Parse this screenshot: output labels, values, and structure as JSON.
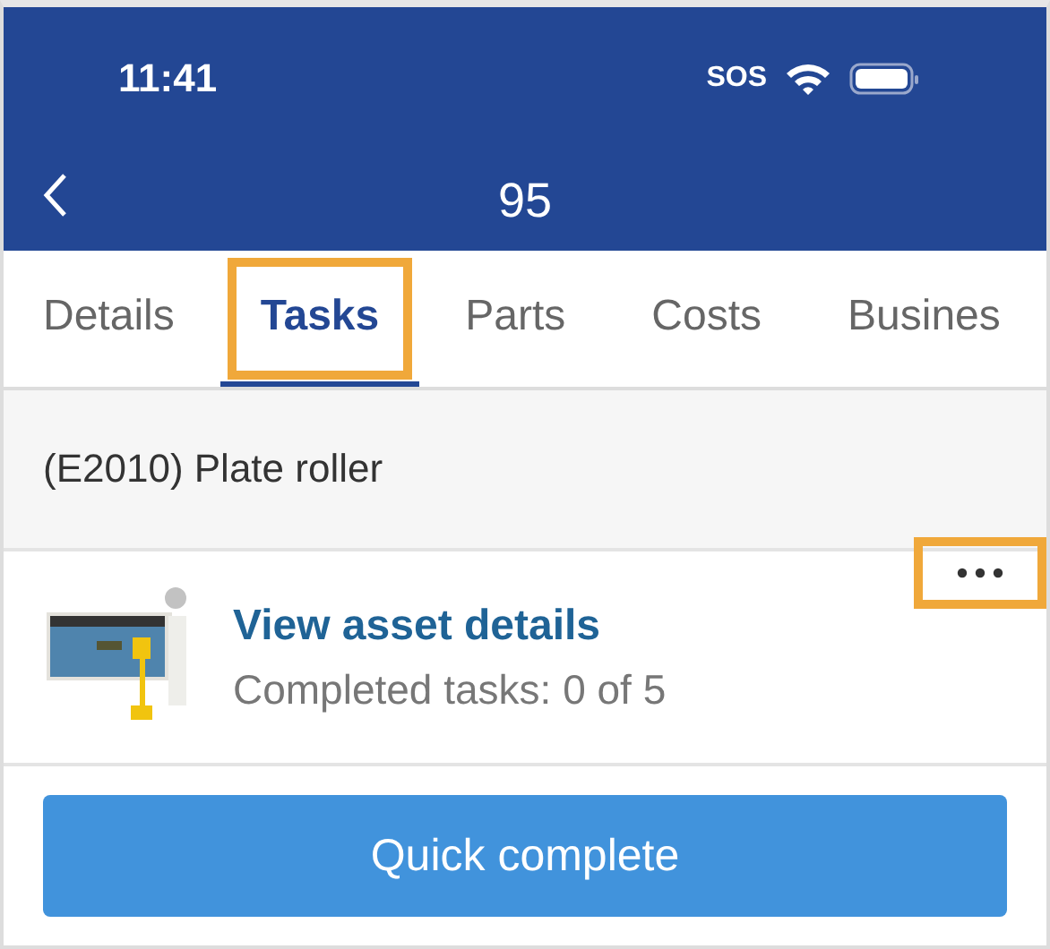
{
  "status_bar": {
    "time": "11:41",
    "sos": "SOS"
  },
  "nav": {
    "title": "95"
  },
  "tabs": [
    {
      "label": "Details",
      "selected": false,
      "highlighted": false
    },
    {
      "label": "Tasks",
      "selected": true,
      "highlighted": true
    },
    {
      "label": "Parts",
      "selected": false,
      "highlighted": false
    },
    {
      "label": "Costs",
      "selected": false,
      "highlighted": false
    },
    {
      "label": "Busines",
      "selected": false,
      "highlighted": false
    }
  ],
  "section": {
    "title": "(E2010) Plate roller"
  },
  "asset": {
    "link": "View asset details",
    "progress": "Completed tasks: 0 of 5",
    "more_highlighted": true
  },
  "action": {
    "label": "Quick complete"
  }
}
